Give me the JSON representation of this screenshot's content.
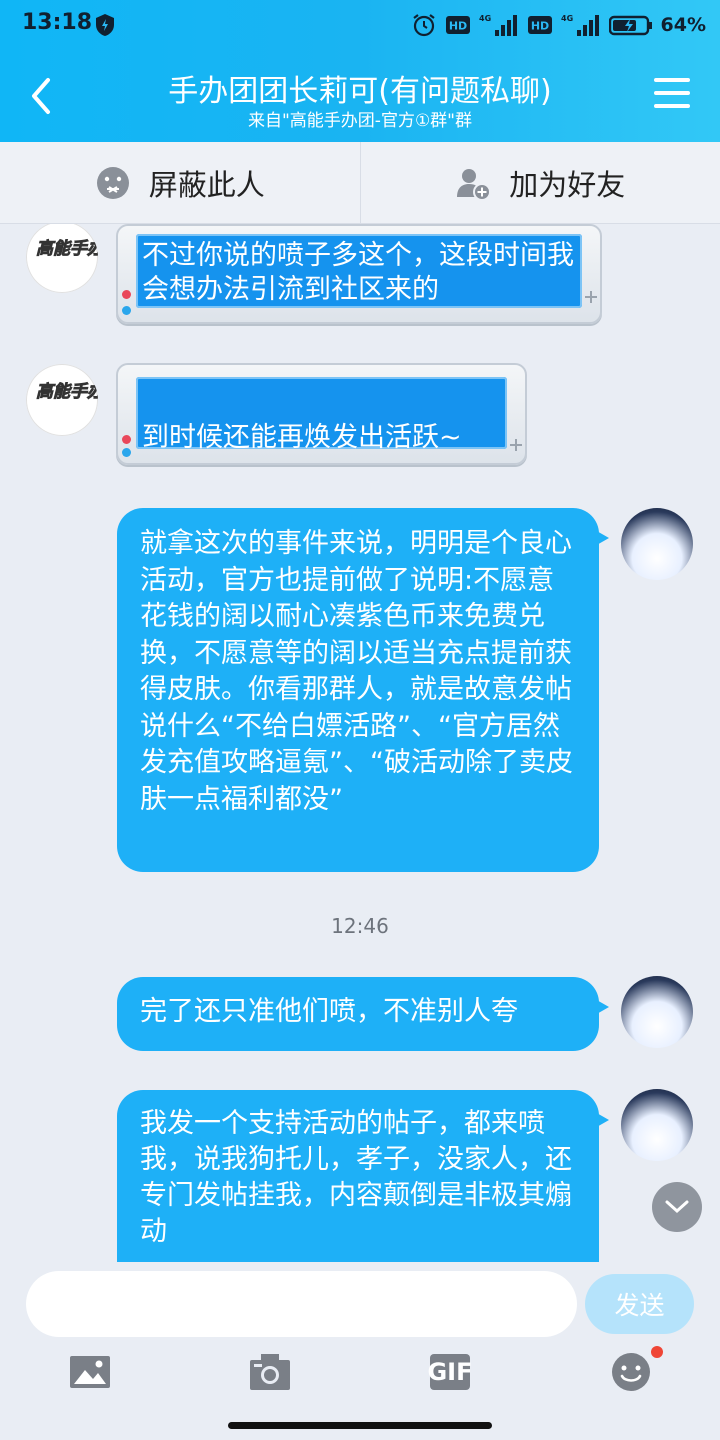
{
  "status_bar": {
    "time": "13:18",
    "network_1": "4G",
    "network_2": "4G",
    "hd_1": "HD",
    "hd_2": "HD",
    "battery": "64%"
  },
  "header": {
    "title": "手办团团长莉可(有问题私聊)",
    "subtitle": "来自\"高能手办团-官方①群\"群"
  },
  "actions": {
    "block_label": "屏蔽此人",
    "add_friend_label": "加为好友"
  },
  "messages": {
    "m1": "不过你说的喷子多这个，这段时间我会想办法引流到社区来的",
    "m2": "到时候还能再焕发出活跃~",
    "m3": "就拿这次的事件来说，明明是个良心活动，官方也提前做了说明:不愿意花钱的阔以耐心凑紫色币来免费兑换，不愿意等的阔以适当充点提前获得皮肤。你看那群人，就是故意发帖说什么“不给白嫖活路”、“官方居然发充值攻略逼氪”、“破活动除了卖皮肤一点福利都没”",
    "timestamp": "12:46",
    "m4": "完了还只准他们喷，不准别人夸",
    "m5": "我发一个支持活动的帖子，都来喷我，说我狗托儿，孝子，没家人，还专门发帖挂我，内容颠倒是非极其煽动"
  },
  "composer": {
    "input_value": "",
    "send_label": "发送",
    "gif_label": "GIF"
  },
  "avatar_logo_text": "高能手办团",
  "colors": {
    "header_gradient_start": "#10b6f6",
    "header_gradient_end": "#32c8f6",
    "my_bubble": "#1eb0f7",
    "framed_screen": "#1593ee",
    "background": "#e9edf4",
    "notification_dot": "#ef4636"
  },
  "icons": [
    "back-icon",
    "menu-icon",
    "block-icon",
    "add-friend-icon",
    "image-icon",
    "camera-icon",
    "gif-icon",
    "emoji-icon",
    "chevron-down-icon",
    "shield-icon",
    "alarm-icon",
    "signal-icon",
    "battery-icon"
  ]
}
